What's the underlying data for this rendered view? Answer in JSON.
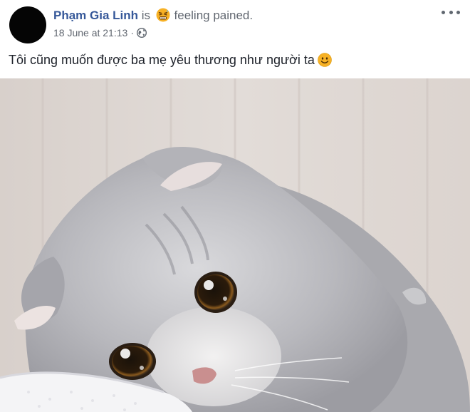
{
  "post": {
    "author_name": "Phạm Gia Linh",
    "is_text": "is",
    "feeling": "feeling pained.",
    "feeling_icon": "pained-face-emoji-icon",
    "timestamp": "18 June at 21:13",
    "separator": "·",
    "privacy_icon": "globe-icon",
    "text": "Tôi cũng muốn được ba mẹ yêu thương như người ta",
    "text_emoji": "smile-emoji-icon",
    "more_icon": "more-options-icon",
    "photo": "sad-gray-scottish-fold-kitten-photo"
  },
  "colors": {
    "author": "#365899",
    "meta": "#616770",
    "text": "#1d2129",
    "emoji": "#f7b125"
  }
}
